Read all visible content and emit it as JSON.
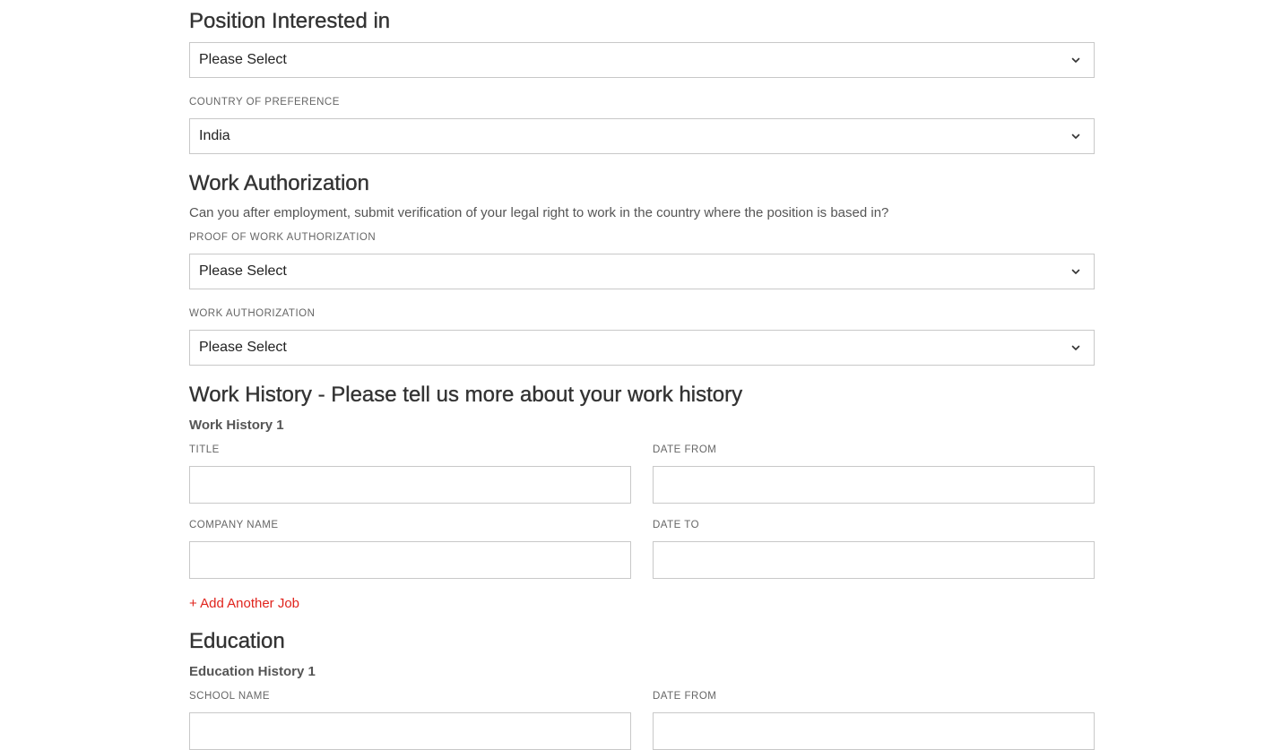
{
  "position": {
    "heading": "Position Interested in",
    "select_value": "Please Select"
  },
  "country": {
    "label": "COUNTRY OF PREFERENCE",
    "select_value": "India"
  },
  "work_authorization": {
    "heading": "Work Authorization",
    "question": "Can you after employment, submit verification of your legal right to work in the country where the position is based in?",
    "proof_label": "PROOF OF WORK AUTHORIZATION",
    "proof_value": "Please Select",
    "auth_label": "WORK AUTHORIZATION",
    "auth_value": "Please Select"
  },
  "work_history": {
    "heading": "Work History - Please tell us more about your work history",
    "entry_title": "Work History 1",
    "title_label": "TITLE",
    "title_value": "",
    "date_from_label": "DATE FROM",
    "date_from_value": "",
    "company_label": "COMPANY NAME",
    "company_value": "",
    "date_to_label": "DATE TO",
    "date_to_value": "",
    "add_link": "+ Add Another Job"
  },
  "education": {
    "heading": "Education",
    "entry_title": "Education History 1",
    "school_label": "SCHOOL NAME",
    "school_value": "",
    "date_from_label": "DATE FROM",
    "date_from_value": ""
  },
  "icons": {
    "select_chevron": "chevron-down-icon"
  },
  "colors": {
    "accent_link": "#e0231c",
    "border": "#c8c8c8"
  }
}
